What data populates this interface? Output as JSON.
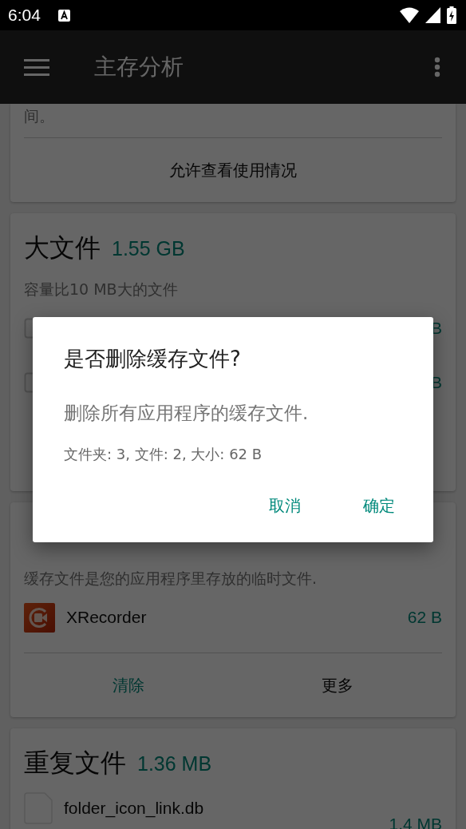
{
  "status_bar": {
    "time": "6:04"
  },
  "app_bar": {
    "title": "主存分析"
  },
  "cards": [
    {
      "kind": "permission",
      "description": "间。",
      "actions": [
        {
          "label": "允许查看使用情况",
          "primary": false
        }
      ]
    },
    {
      "kind": "files",
      "title": "大文件",
      "size": "1.55 GB",
      "description": "容量比10 MB大的文件",
      "rows": [
        {
          "kind": "checkbox",
          "size": "B"
        },
        {
          "kind": "checkbox",
          "size": "B"
        }
      ]
    },
    {
      "kind": "files",
      "description": "缓存文件是您的应用程序里存放的临时文件.",
      "rows": [
        {
          "kind": "app",
          "name": "XRecorder",
          "size": "62 B"
        }
      ],
      "actions": [
        {
          "label": "清除",
          "primary": true
        },
        {
          "label": "更多",
          "primary": false
        }
      ]
    },
    {
      "kind": "files",
      "title": "重复文件",
      "size": "1.36 MB",
      "rows": [
        {
          "kind": "file",
          "name": "folder_icon_link.db",
          "size": "1.4 MB"
        }
      ]
    }
  ],
  "dialog": {
    "title": "是否删除缓存文件?",
    "message": "删除所有应用程序的缓存文件.",
    "details": "文件夹: 3, 文件: 2, 大小: 62 B",
    "buttons": [
      {
        "label": "取消"
      },
      {
        "label": "确定"
      }
    ]
  }
}
